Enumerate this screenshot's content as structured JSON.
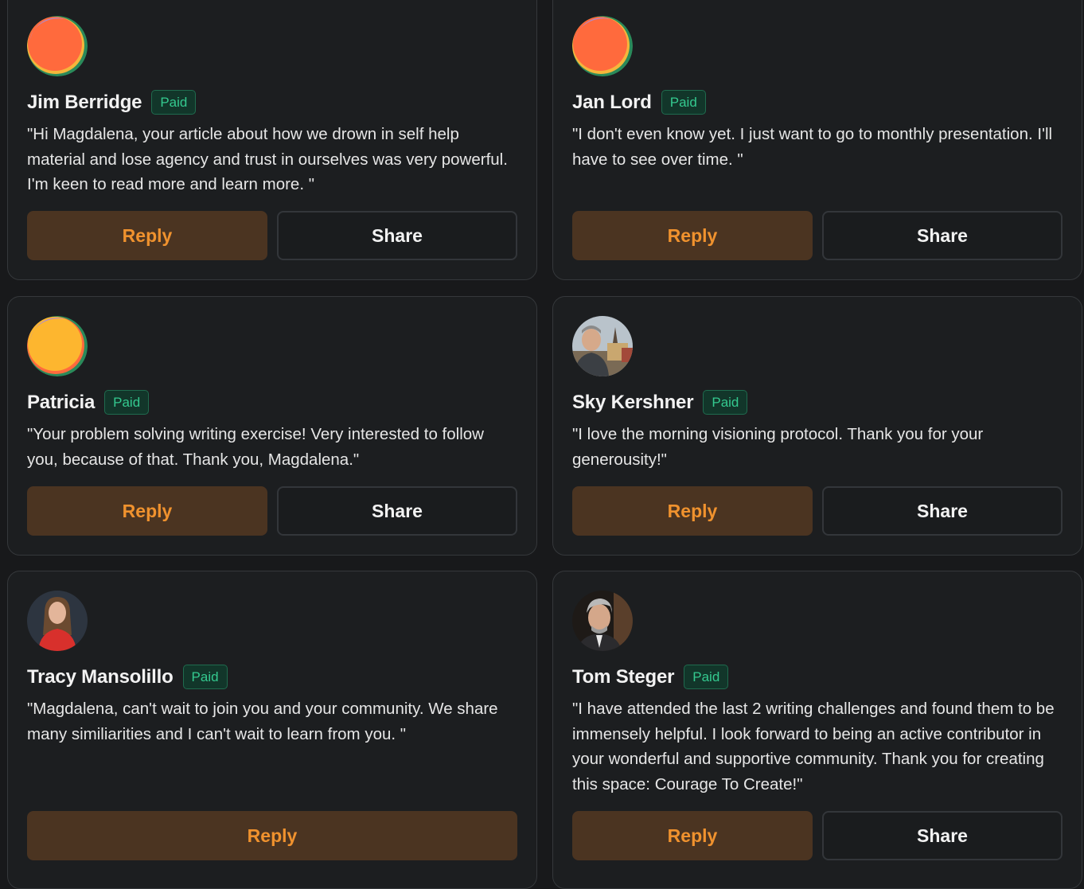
{
  "comments": [
    {
      "name": "Jim Berridge",
      "badge": "Paid",
      "avatar": "gradient-orange-icon",
      "quote": "\"Hi Magdalena, your article about how we drown in self help material and lose agency and trust in ourselves was very powerful. I'm keen to read more and learn more. \"",
      "reply": "Reply",
      "share": "Share"
    },
    {
      "name": "Jan Lord",
      "badge": "Paid",
      "avatar": "gradient-orange-icon",
      "quote": "\"I don't even know yet. I just want to go to monthly presentation. I'll have to see over time. \"",
      "reply": "Reply",
      "share": "Share"
    },
    {
      "name": "Patricia",
      "badge": "Paid",
      "avatar": "gradient-yellow-icon",
      "quote": "\"Your problem solving writing exercise! Very interested to follow you, because of that. Thank you, Magdalena.\"",
      "reply": "Reply",
      "share": "Share"
    },
    {
      "name": "Sky Kershner",
      "badge": "Paid",
      "avatar": "photo-man-outdoors",
      "quote": "\"I love the morning visioning protocol. Thank you for your generousity!\"",
      "reply": "Reply",
      "share": "Share"
    },
    {
      "name": "Tracy Mansolillo",
      "badge": "Paid",
      "avatar": "photo-woman-red-top",
      "quote": "\"Magdalena, can't wait to join you and your community. We share many similiarities and I can't wait to learn from you. \"",
      "reply": "Reply"
    },
    {
      "name": "Tom Steger",
      "badge": "Paid",
      "avatar": "photo-man-grey-hair",
      "quote": "\"I have attended the last 2 writing challenges and found them to be immensely helpful. I look forward to being an active contributor in your wonderful and supportive community. Thank you for creating this space: Courage To Create!\"",
      "reply": "Reply",
      "share": "Share"
    }
  ],
  "colors": {
    "background": "#18191b",
    "card": "#1c1e20",
    "reply_bg": "#4b3421",
    "reply_text": "#f0922e",
    "badge_text": "#34c98f",
    "badge_bg": "#12362a"
  }
}
